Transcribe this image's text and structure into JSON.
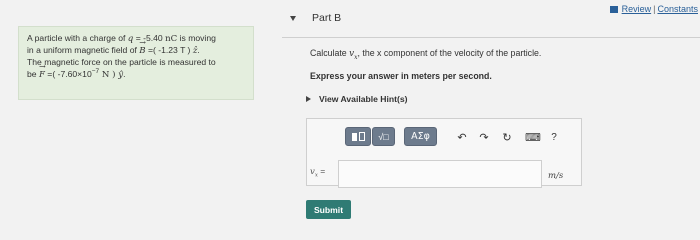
{
  "problem": {
    "l1_pre": "A particle with a charge of ",
    "l1_q": "q",
    "l1_eq": " = -5.40 ",
    "l1_unit": "nC",
    "l1_post": " is moving",
    "l2_pre": "in a uniform magnetic field of ",
    "l2_B": "B",
    "l2_val": " =( -1.23 T ) ",
    "l2_z": "ẑ",
    "l2_end": ".",
    "l3": "The magnetic force on the particle is measured to",
    "l4_pre": "be ",
    "l4_F": "F",
    "l4_val": " =( -7.60×10",
    "l4_exp": "−7",
    "l4_unit": " N ) ",
    "l4_y": "ŷ",
    "l4_end": "."
  },
  "links": {
    "review": "Review",
    "separator": "|",
    "constants": "Constants"
  },
  "part": {
    "title": "Part B"
  },
  "instruction": {
    "pre": "Calculate ",
    "var": "v",
    "sub": "x",
    "post": ", the x component of the velocity of the particle.",
    "line2": "Express your answer in meters per second."
  },
  "hints": {
    "label": "View Available Hint(s)"
  },
  "toolbar": {
    "sqrt_label": "√□",
    "greek_label": "ΑΣφ",
    "undo_glyph": "↶",
    "redo_glyph": "↷",
    "reset_glyph": "↻",
    "keyboard_glyph": "⌨",
    "help_glyph": "?"
  },
  "answer": {
    "var_label": "v",
    "var_sub": "x",
    "equals": " =",
    "value": "",
    "unit": "m/s"
  },
  "submit": {
    "label": "Submit"
  }
}
